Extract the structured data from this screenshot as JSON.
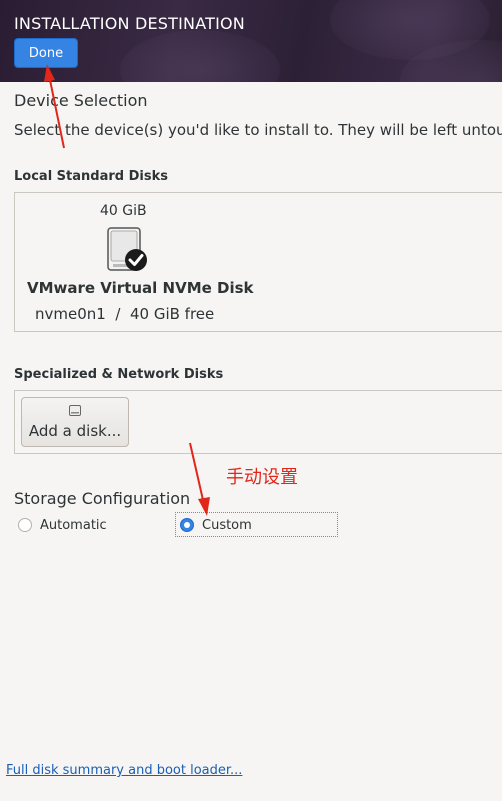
{
  "header": {
    "title": "INSTALLATION DESTINATION",
    "done_label": "Done"
  },
  "device_selection": {
    "title": "Device Selection",
    "description": "Select the device(s) you'd like to install to.  They will be left untou"
  },
  "local_disks": {
    "title": "Local Standard Disks",
    "disk": {
      "size": "40 GiB",
      "name": "VMware Virtual NVMe Disk",
      "device": "nvme0n1",
      "free": "40 GiB free",
      "selected": true
    }
  },
  "network_disks": {
    "title": "Specialized & Network Disks",
    "add_label": "Add a disk..."
  },
  "storage_config": {
    "title": "Storage Configuration",
    "options": [
      {
        "label": "Automatic",
        "checked": false
      },
      {
        "label": "Custom",
        "checked": true
      }
    ]
  },
  "annotation": {
    "text": "手动设置",
    "color": "#e0271a"
  },
  "footer": {
    "link": "Full disk summary and boot loader..."
  },
  "colors": {
    "accent": "#3584e4",
    "link": "#1a5fb4"
  }
}
